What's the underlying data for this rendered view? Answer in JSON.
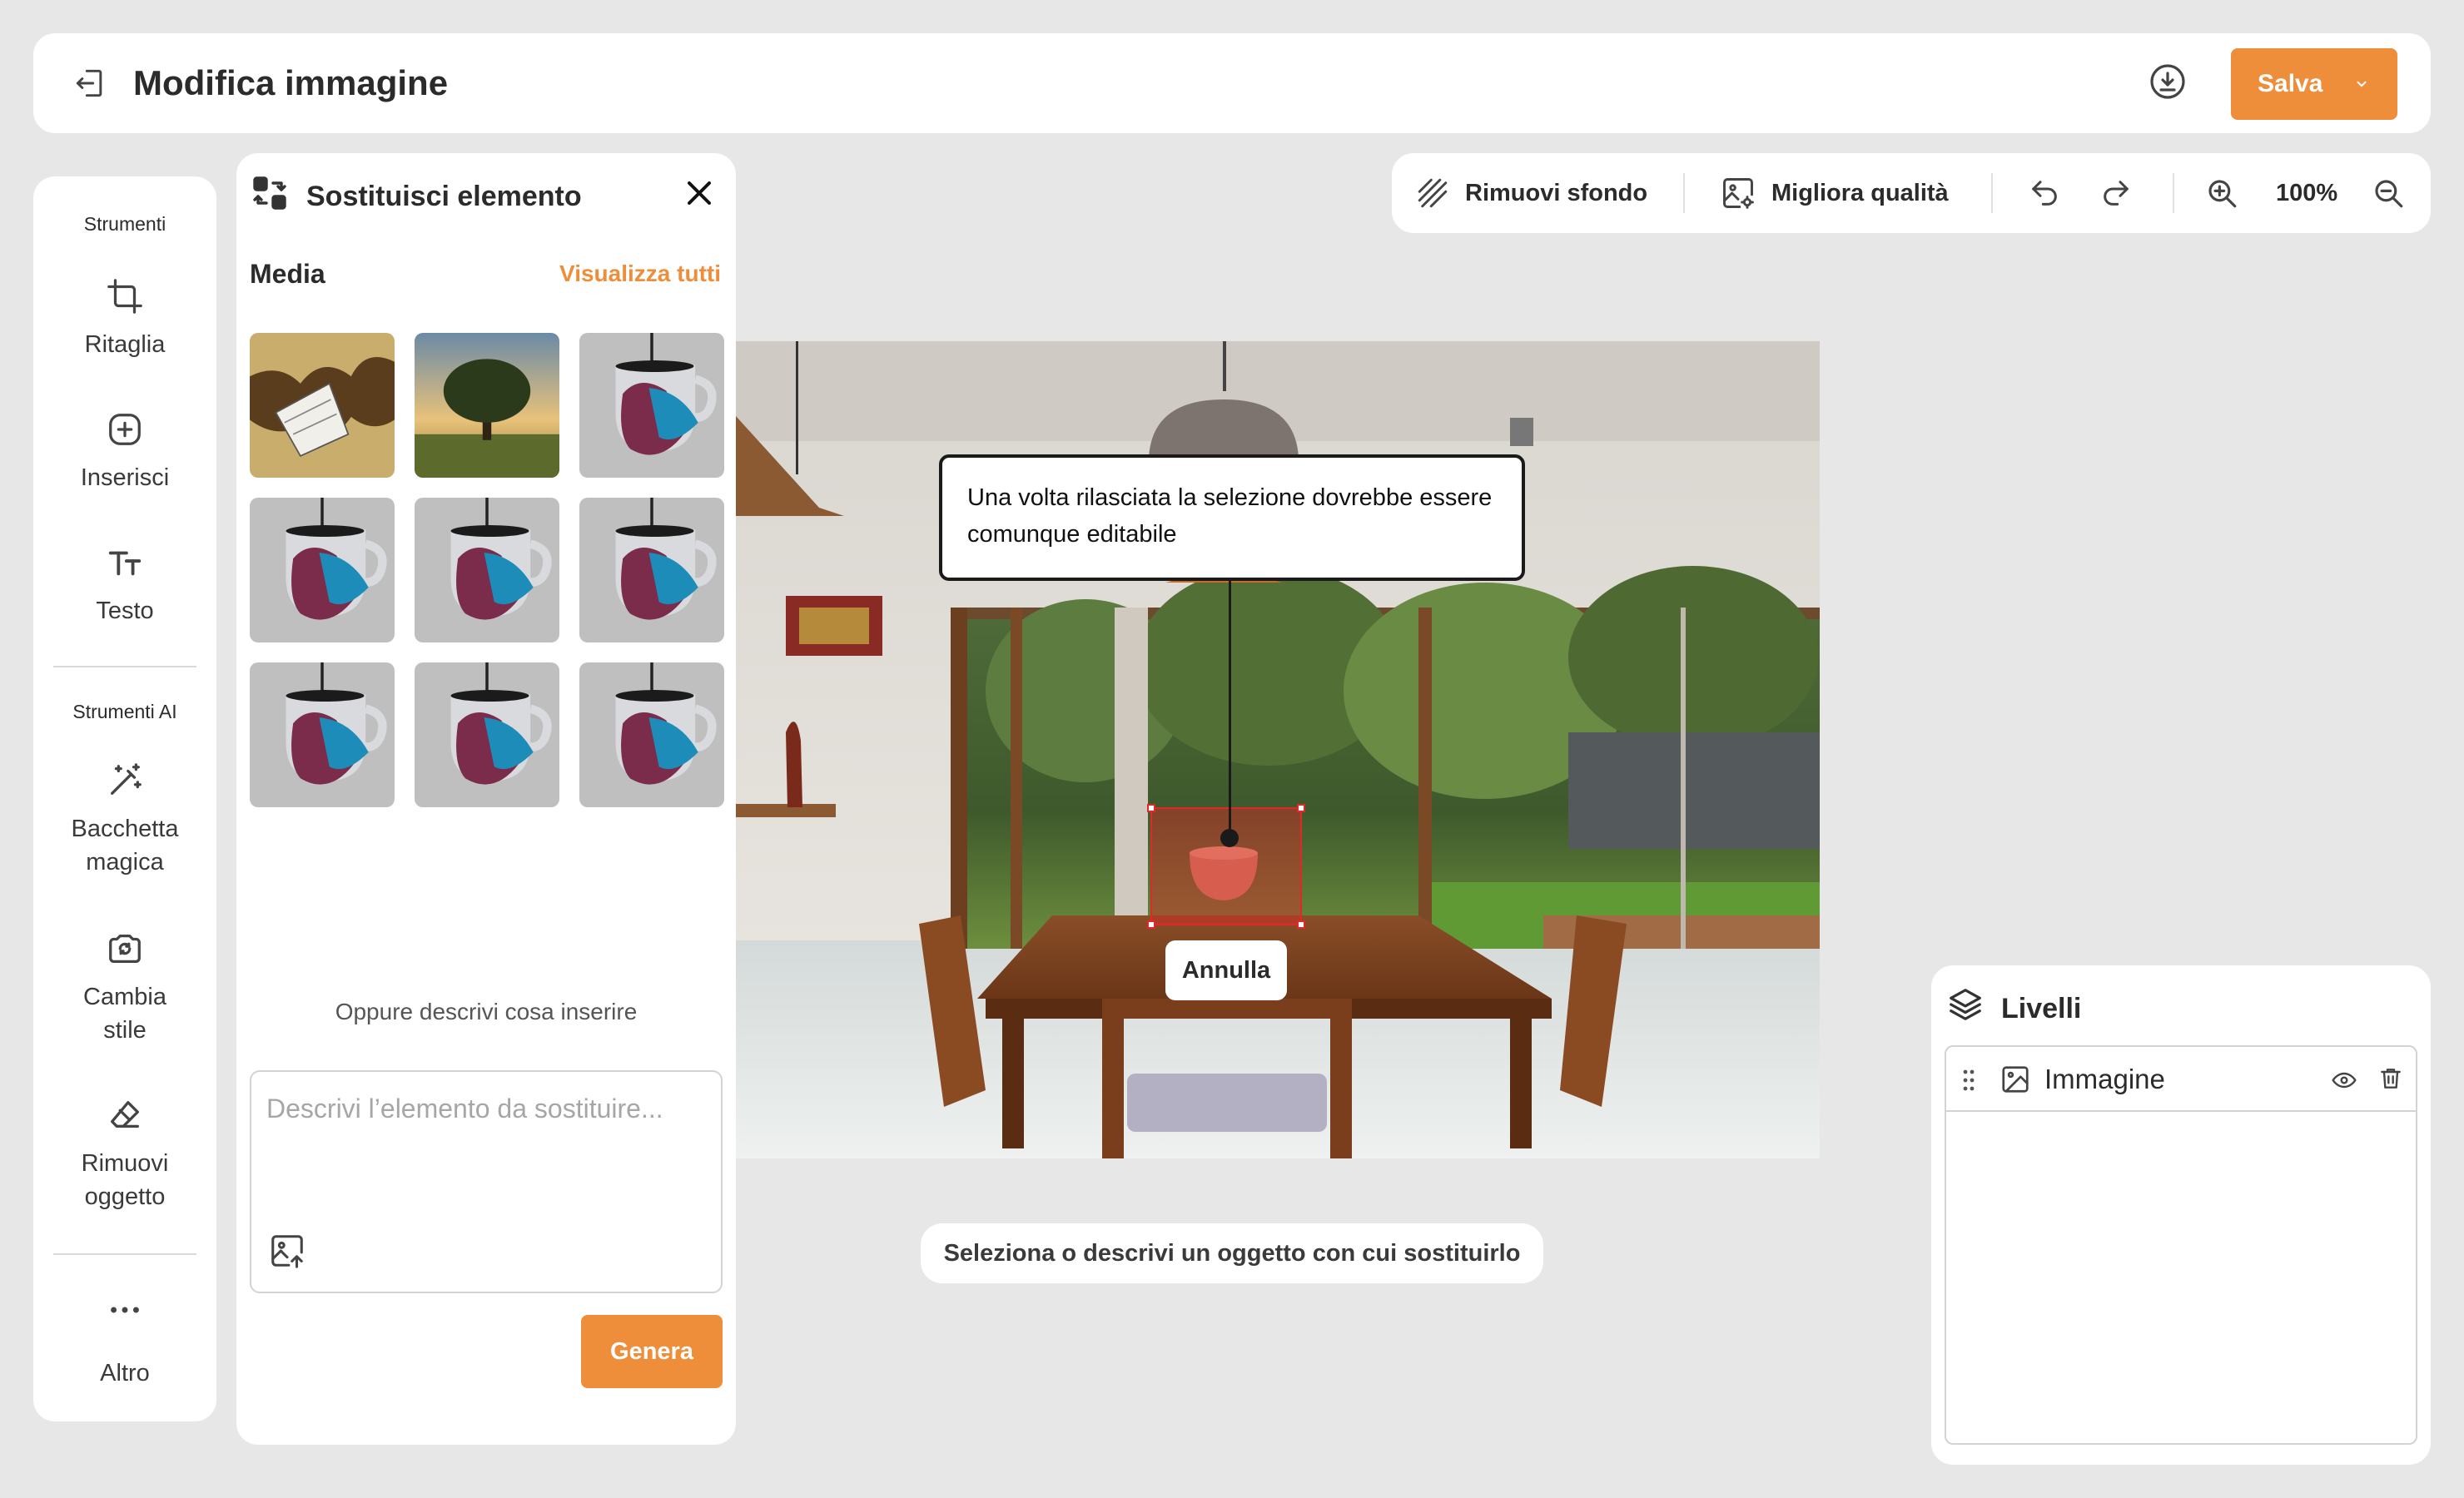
{
  "header": {
    "title": "Modifica immagine",
    "save_label": "Salva"
  },
  "tools": {
    "section_label": "Strumenti",
    "items": [
      {
        "label": "Ritaglia",
        "icon": "crop-icon"
      },
      {
        "label": "Inserisci",
        "icon": "add-square-icon"
      },
      {
        "label": "Testo",
        "icon": "text-icon"
      }
    ],
    "ai_section_label": "Strumenti AI",
    "ai_items": [
      {
        "label": "Bacchetta\nmagica",
        "icon": "magic-wand-icon"
      },
      {
        "label": "Cambia\nstile",
        "icon": "camera-swap-icon"
      },
      {
        "label": "Rimuovi\noggetto",
        "icon": "eraser-icon"
      }
    ],
    "more_label": "Altro"
  },
  "panel": {
    "title": "Sostituisci elemento",
    "media_label": "Media",
    "view_all_label": "Visualizza tutti",
    "describe_or": "Oppure descrivi cosa inserire",
    "prompt_placeholder": "Descrivi l’elemento da sostituire...",
    "generate_label": "Genera"
  },
  "toolbar": {
    "remove_bg_label": "Rimuovi sfondo",
    "enhance_label": "Migliora qualità",
    "zoom_level": "100%"
  },
  "canvas": {
    "tooltip": "Una volta rilasciata la selezione dovrebbe essere comunque editabile",
    "cancel_label": "Annulla"
  },
  "hint": "Seleziona o descrivi un oggetto con cui sostituirlo",
  "layers": {
    "title": "Livelli",
    "items": [
      {
        "name": "Immagine"
      }
    ]
  },
  "colors": {
    "accent": "#ee8e3b",
    "background": "#e7e7e7",
    "selection": "#e02828"
  }
}
